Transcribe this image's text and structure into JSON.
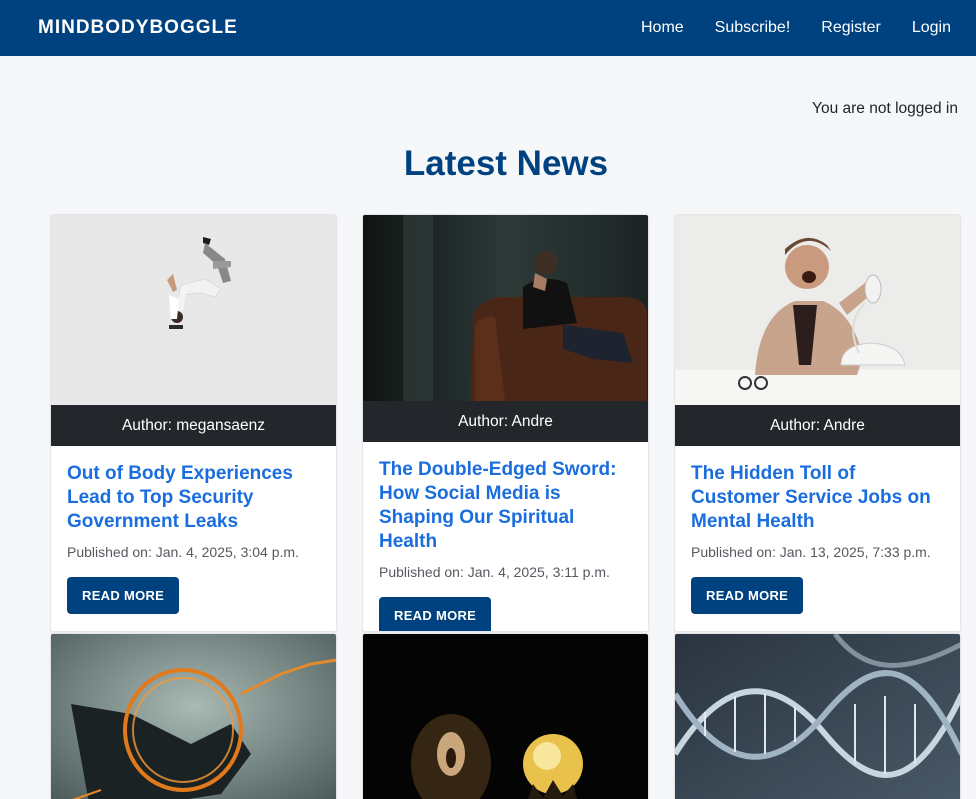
{
  "navbar": {
    "brand": "MINDBODYBOGGLE",
    "links": [
      "Home",
      "Subscribe!",
      "Register",
      "Login"
    ]
  },
  "login_status": "You are not logged in",
  "page_title": "Latest News",
  "articles": [
    {
      "author": "Author: megansaenz",
      "title": "Out of Body Experiences Lead to Top Security Government Leaks",
      "published": "Published on: Jan. 4, 2025, 3:04 p.m.",
      "button": "READ MORE",
      "image": "falling-man-image"
    },
    {
      "author": "Author: Andre",
      "title": "The Double-Edged Sword: How Social Media is Shaping Our Spiritual Health",
      "published": "Published on: Jan. 4, 2025, 3:11 p.m.",
      "button": "READ MORE",
      "image": "man-on-couch-image"
    },
    {
      "author": "Author: Andre",
      "title": "The Hidden Toll of Customer Service Jobs on Mental Health",
      "published": "Published on: Jan. 13, 2025, 7:33 p.m.",
      "button": "READ MORE",
      "image": "man-yelling-phone-image"
    },
    {
      "image": "fire-ring-image"
    },
    {
      "image": "crystal-ball-image"
    },
    {
      "image": "dna-helix-image"
    }
  ],
  "colors": {
    "primary": "#00417f",
    "link": "#1a6dde",
    "author_bar": "#23272b",
    "background": "#f6f7f9"
  }
}
